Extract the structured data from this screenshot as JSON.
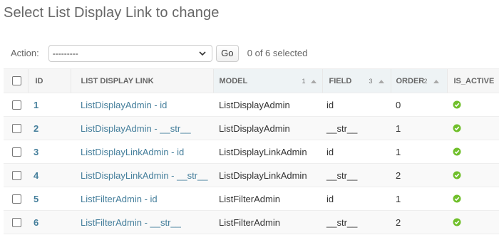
{
  "page": {
    "title": "Select List Display Link to change"
  },
  "actions": {
    "label": "Action:",
    "selected_option": "---------",
    "go_label": "Go",
    "counter": "0 of 6 selected"
  },
  "table": {
    "headers": {
      "id": "ID",
      "link": "LIST DISPLAY LINK",
      "model": "MODEL",
      "model_priority": "1",
      "field": "FIELD",
      "field_priority": "3",
      "order": "ORDER",
      "order_priority": "2",
      "is_active": "IS_ACTIVE"
    },
    "rows": [
      {
        "id": "1",
        "link": "ListDisplayAdmin - id",
        "model": "ListDisplayAdmin",
        "field": "id",
        "order": "0",
        "is_active": true
      },
      {
        "id": "2",
        "link": "ListDisplayAdmin - __str__",
        "model": "ListDisplayAdmin",
        "field": "__str__",
        "order": "1",
        "is_active": true
      },
      {
        "id": "3",
        "link": "ListDisplayLinkAdmin - id",
        "model": "ListDisplayLinkAdmin",
        "field": "id",
        "order": "1",
        "is_active": true
      },
      {
        "id": "4",
        "link": "ListDisplayLinkAdmin - __str__",
        "model": "ListDisplayLinkAdmin",
        "field": "__str__",
        "order": "2",
        "is_active": true
      },
      {
        "id": "5",
        "link": "ListFilterAdmin - id",
        "model": "ListFilterAdmin",
        "field": "id",
        "order": "1",
        "is_active": true
      },
      {
        "id": "6",
        "link": "ListFilterAdmin - __str__",
        "model": "ListFilterAdmin",
        "field": "__str__",
        "order": "2",
        "is_active": true
      }
    ]
  },
  "colors": {
    "link": "#447e9b",
    "active_icon": "#70bf2b",
    "header_bg": "#f6f6f6",
    "sorted_header_bg": "#eef3f5"
  },
  "icons": {
    "sort": "sort-ascending-icon",
    "active": "checkmark-circle-icon",
    "dropdown": "chevron-down-icon"
  }
}
